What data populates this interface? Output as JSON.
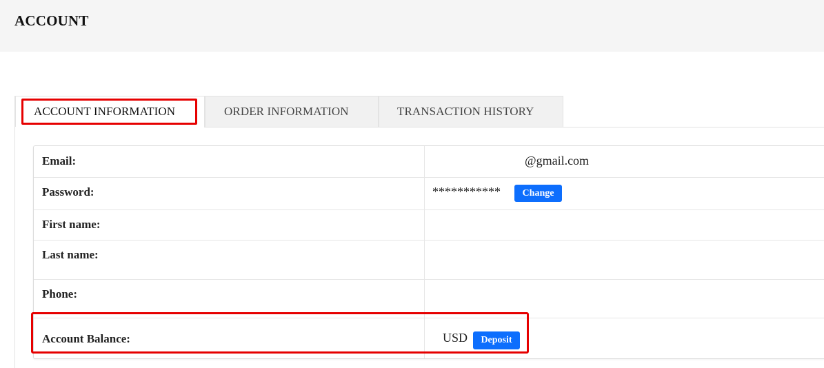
{
  "header": {
    "title": "ACCOUNT"
  },
  "tabs": [
    {
      "label": "ACCOUNT INFORMATION",
      "active": true
    },
    {
      "label": "ORDER INFORMATION",
      "active": false
    },
    {
      "label": "TRANSACTION HISTORY",
      "active": false
    }
  ],
  "account": {
    "email_label": "Email:",
    "email_value": "@gmail.com",
    "password_label": "Password:",
    "password_value": "***********",
    "change_button": "Change",
    "first_name_label": "First name:",
    "first_name_value": "",
    "last_name_label": "Last name:",
    "last_name_value": "",
    "phone_label": "Phone:",
    "phone_value": "",
    "balance_label": "Account Balance:",
    "balance_value": "USD",
    "deposit_button": "Deposit"
  },
  "colors": {
    "accent": "#0d6efd",
    "highlight": "#e60000",
    "header_bg": "#f5f5f5"
  }
}
